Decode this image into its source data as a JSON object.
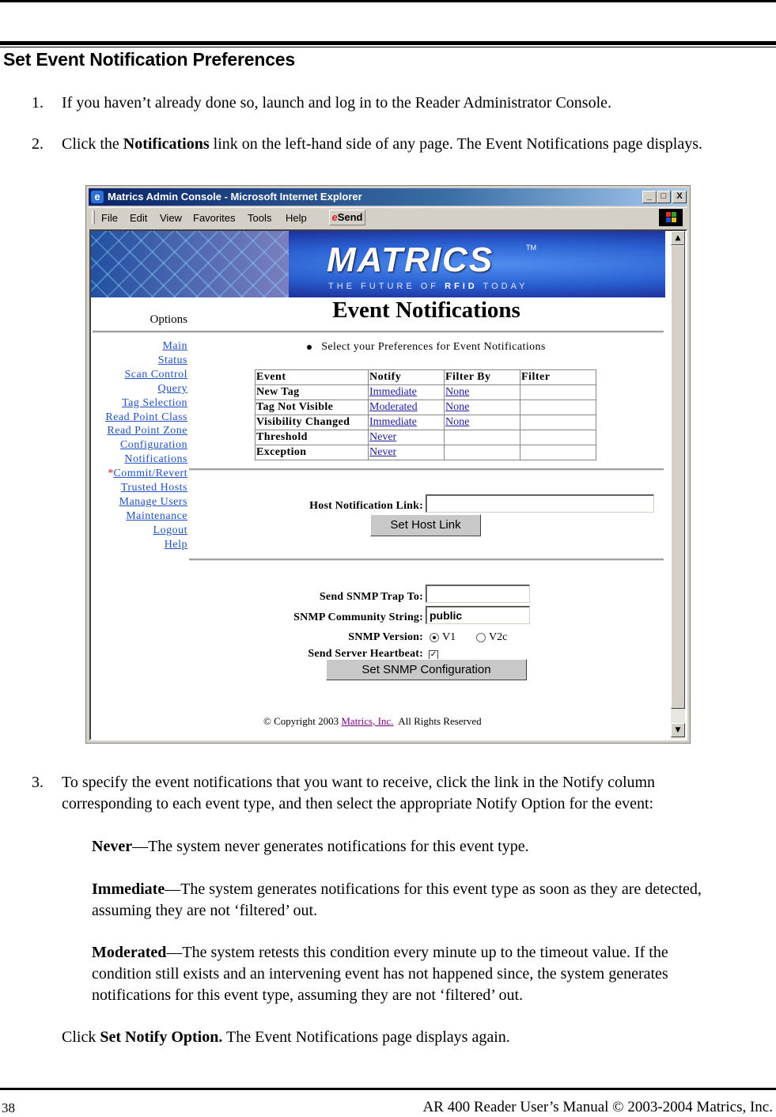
{
  "document": {
    "heading": "Set Event Notification Preferences",
    "steps": [
      {
        "num": "1.",
        "text": "If you haven’t already done so, launch and log in to the Reader Administrator Console."
      },
      {
        "num": "2.",
        "pre": "Click the ",
        "bold": "Notifications",
        "post": " link on the left-hand side of any page. The Event Notifications page displays."
      },
      {
        "num": "3.",
        "line1": "To specify the event notifications that you want to receive, click the link in the Notify column",
        "line2": "corresponding to each event type, and then select the appropriate Notify Option for the event:"
      }
    ],
    "options": [
      {
        "term": "Never",
        "desc": "—The system never generates notifications for this event type."
      },
      {
        "term": "Immediate",
        "desc": "—The system generates notifications for this event type as soon as they are detected,",
        "desc2": "assuming they are not ‘filtered’ out."
      },
      {
        "term": "Moderated",
        "desc": "—The system retests this condition every minute up to the timeout value. If the",
        "desc2": "condition still exists and an intervening event has not happened since, the system generates",
        "desc3": "notifications for this event type, assuming they are not ‘filtered’ out."
      }
    ],
    "final": {
      "pre": "Click ",
      "bold": "Set Notify Option.",
      "post": " The Event Notifications page displays again."
    },
    "footer": {
      "page": "38",
      "title": "AR 400 Reader User’s Manual © 2003-2004 Matrics, Inc."
    }
  },
  "browser": {
    "title": "Matrics Admin Console - Microsoft Internet Explorer",
    "menu": [
      "File",
      "Edit",
      "View",
      "Favorites",
      "Tools",
      "Help"
    ],
    "send_label": "Send",
    "window_buttons": {
      "minimize": "_",
      "maximize": "□",
      "close": "X"
    }
  },
  "banner": {
    "logo": "MATRICS",
    "tm": "TM",
    "tagline_pre": "THE FUTURE OF ",
    "tagline_bold": "RFID",
    "tagline_post": " TODAY"
  },
  "page": {
    "title": "Event Notifications",
    "options_label": "Options",
    "bullet": "Select your Preferences for Event Notifications",
    "sidebar": [
      {
        "label": "Main"
      },
      {
        "label": "Status"
      },
      {
        "label": "Scan Control"
      },
      {
        "label": "Query"
      },
      {
        "label": "Tag Selection"
      },
      {
        "label": "Read Point Class"
      },
      {
        "label": "Read Point Zone"
      },
      {
        "label": "Configuration"
      },
      {
        "label": "Notifications"
      },
      {
        "label": "Commit/Revert",
        "marker": "*"
      },
      {
        "label": "Trusted Hosts"
      },
      {
        "label": "Manage Users"
      },
      {
        "label": "Maintenance"
      },
      {
        "label": "Logout"
      },
      {
        "label": "Help"
      }
    ],
    "table": {
      "headers": [
        "Event",
        "Notify",
        "Filter By",
        "Filter"
      ],
      "rows": [
        {
          "event": "New Tag",
          "notify": "Immediate",
          "filter_by": "None",
          "filter": ""
        },
        {
          "event": "Tag Not Visible",
          "notify": "Moderated",
          "filter_by": "None",
          "filter": ""
        },
        {
          "event": "Visibility Changed",
          "notify": "Immediate",
          "filter_by": "None",
          "filter": ""
        },
        {
          "event": "Threshold",
          "notify": "Never",
          "filter_by": "",
          "filter": ""
        },
        {
          "event": "Exception",
          "notify": "Never",
          "filter_by": "",
          "filter": ""
        }
      ]
    },
    "host_link": {
      "label": "Host Notification Link:",
      "value": "",
      "button": "Set Host Link"
    },
    "snmp": {
      "trap_label": "Send SNMP Trap To:",
      "trap_value": "",
      "community_label": "SNMP Community String:",
      "community_value": "public",
      "version_label": "SNMP Version:",
      "versions": [
        {
          "label": "V1",
          "selected": true
        },
        {
          "label": "V2c",
          "selected": false
        }
      ],
      "heartbeat_label": "Send Server Heartbeat:",
      "heartbeat_checked": true,
      "button": "Set SNMP Configuration"
    },
    "copyright": {
      "pre": "© Copyright 2003 ",
      "link": "Matrics, Inc.",
      "post": "  All Rights Reserved"
    }
  }
}
